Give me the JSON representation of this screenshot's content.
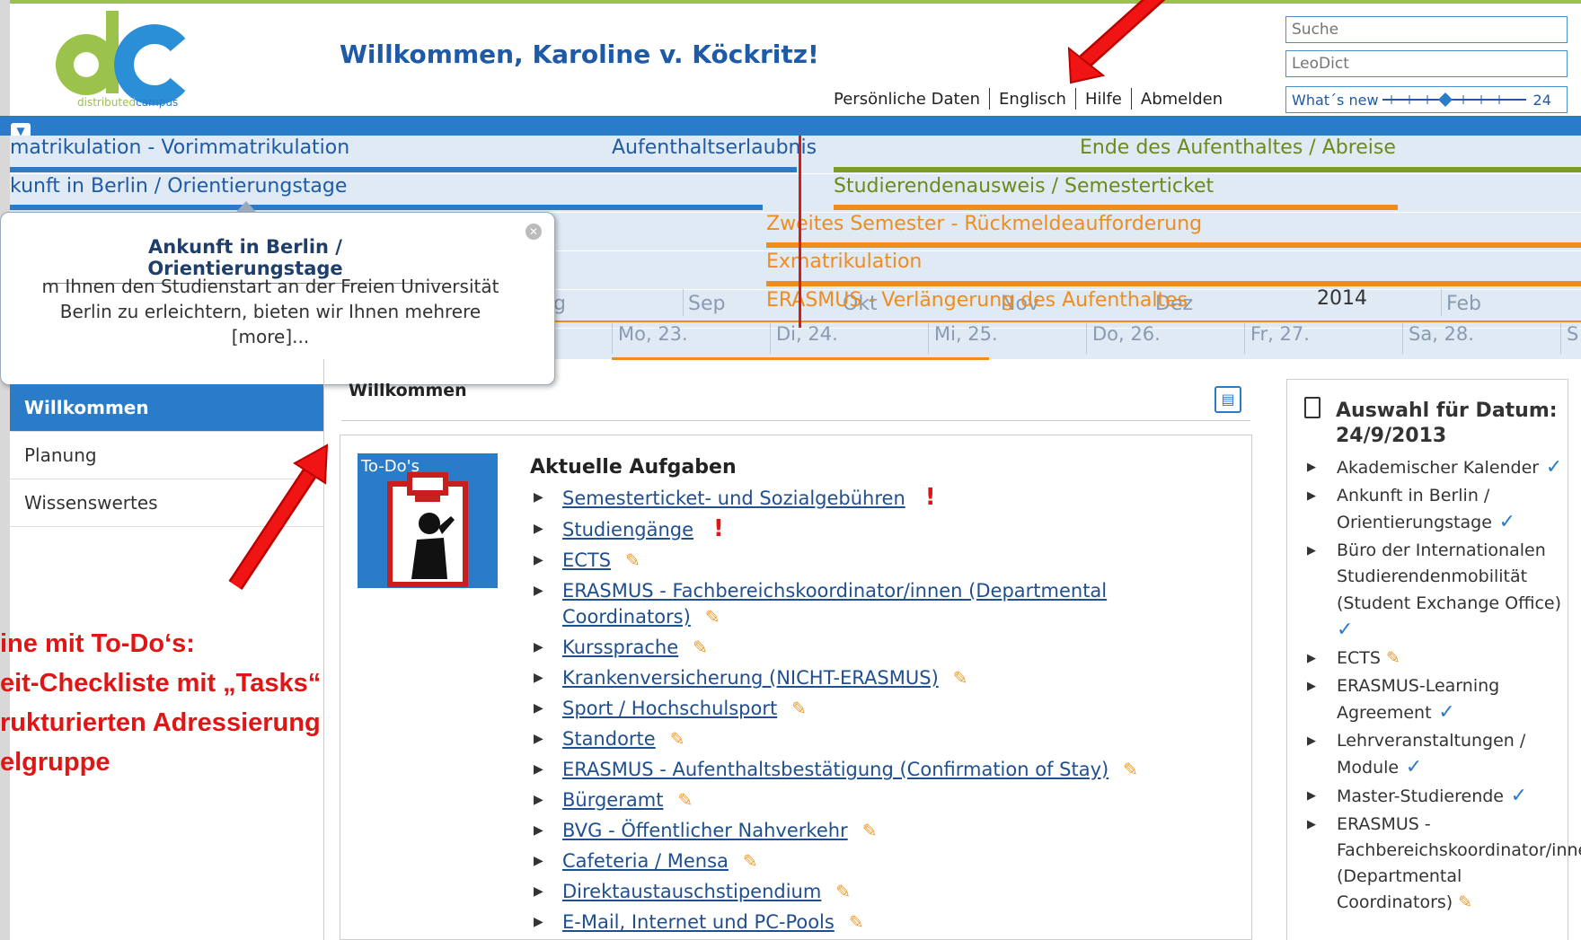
{
  "header": {
    "welcome": "Willkommen, Karoline v. Köckritz!",
    "logo_text": "distributedcampus",
    "nav": [
      "Persönliche Daten",
      "Englisch",
      "Hilfe",
      "Abmelden"
    ],
    "search_placeholder": "Suche",
    "leodict_placeholder": "LeoDict",
    "whats_new": "What´s new",
    "whats_new_count": "24"
  },
  "timeline": {
    "rows": [
      {
        "left": "matrikulation - Vorimmatrikulation",
        "mid": "Aufenthaltserlaubnis",
        "right": "Ende des Aufenthaltes / Abreise"
      },
      {
        "left": "kunft in Berlin / Orientierungstage",
        "right": "Studierendenausweis / Semesterticket"
      },
      {
        "right": "Zweites Semester - Rückmeldeaufforderung"
      },
      {
        "right": "Exmatrikulation"
      },
      {
        "right": "ERASMUS - Verlängerung des Aufenthaltes"
      }
    ],
    "months": [
      "g",
      "Sep",
      "Okt",
      "Nov",
      "Dez",
      "2014",
      "Feb"
    ],
    "days": [
      "Mo, 23.",
      "Di, 24.",
      "Mi, 25.",
      "Do, 26.",
      "Fr, 27.",
      "Sa, 28.",
      "S"
    ]
  },
  "popup": {
    "title": "Ankunft in Berlin / Orientierungstage",
    "body_line1": "m Ihnen den Studienstart an der Freien Universität",
    "body_line2": "Berlin zu erleichtern, bieten wir Ihnen mehrere",
    "more": "[more]..."
  },
  "sidebar": {
    "items": [
      "Willkommen",
      "Planung",
      "Wissenswertes"
    ]
  },
  "callout": {
    "line1": "ine mit To-Do‘s:",
    "line2": "eit-Checkliste mit „Tasks“",
    "line3": "rukturierten Adressierung",
    "line4": "elgruppe"
  },
  "main": {
    "heading": "Willkommen",
    "todo_label": "To-Do's",
    "tasks_title": "Aktuelle Aufgaben",
    "tasks": [
      {
        "label": "Semesterticket- und Sozialgebühren",
        "mark": "excl"
      },
      {
        "label": "Studiengänge",
        "mark": "excl"
      },
      {
        "label": "ECTS",
        "mark": "pencil"
      },
      {
        "label": "ERASMUS - Fachbereichskoordinator/innen (Departmental Coordinators)",
        "mark": "pencil"
      },
      {
        "label": "Kurssprache",
        "mark": "pencil"
      },
      {
        "label": "Krankenversicherung (NICHT-ERASMUS)",
        "mark": "pencil"
      },
      {
        "label": "Sport / Hochschulsport",
        "mark": "pencil"
      },
      {
        "label": "Standorte",
        "mark": "pencil"
      },
      {
        "label": "ERASMUS - Aufenthaltsbestätigung (Confirmation of Stay)",
        "mark": "pencil"
      },
      {
        "label": "Bürgeramt",
        "mark": "pencil"
      },
      {
        "label": "BVG - Öffentlicher Nahverkehr",
        "mark": "pencil"
      },
      {
        "label": "Cafeteria / Mensa",
        "mark": "pencil"
      },
      {
        "label": "Direktaustauschstipendium",
        "mark": "pencil"
      },
      {
        "label": "E-Mail, Internet und PC-Pools",
        "mark": "pencil"
      }
    ]
  },
  "rightcol": {
    "title_line1": "Auswahl für Datum:",
    "title_line2": "24/9/2013",
    "items": [
      {
        "label": "Akademischer Kalender",
        "mark": "check"
      },
      {
        "label": "Ankunft in Berlin / Orientierungstage",
        "mark": "check"
      },
      {
        "label": "Büro der Internationalen Studierendenmobilität (Student Exchange Office)",
        "mark": "check"
      },
      {
        "label": "ECTS",
        "mark": "pencil"
      },
      {
        "label": "ERASMUS-Learning Agreement",
        "mark": "check"
      },
      {
        "label": "Lehrveranstaltungen / Module",
        "mark": "check"
      },
      {
        "label": "Master-Studierende",
        "mark": "check"
      },
      {
        "label": "ERASMUS - Fachbereichskoordinator/innen (Departmental Coordinators)",
        "mark": "pencil"
      }
    ]
  },
  "colors": {
    "brand_blue": "#2b7cc8",
    "accent_orange": "#ef8c1e",
    "logo_green": "#9bc24a",
    "alert_red": "#e01515"
  }
}
